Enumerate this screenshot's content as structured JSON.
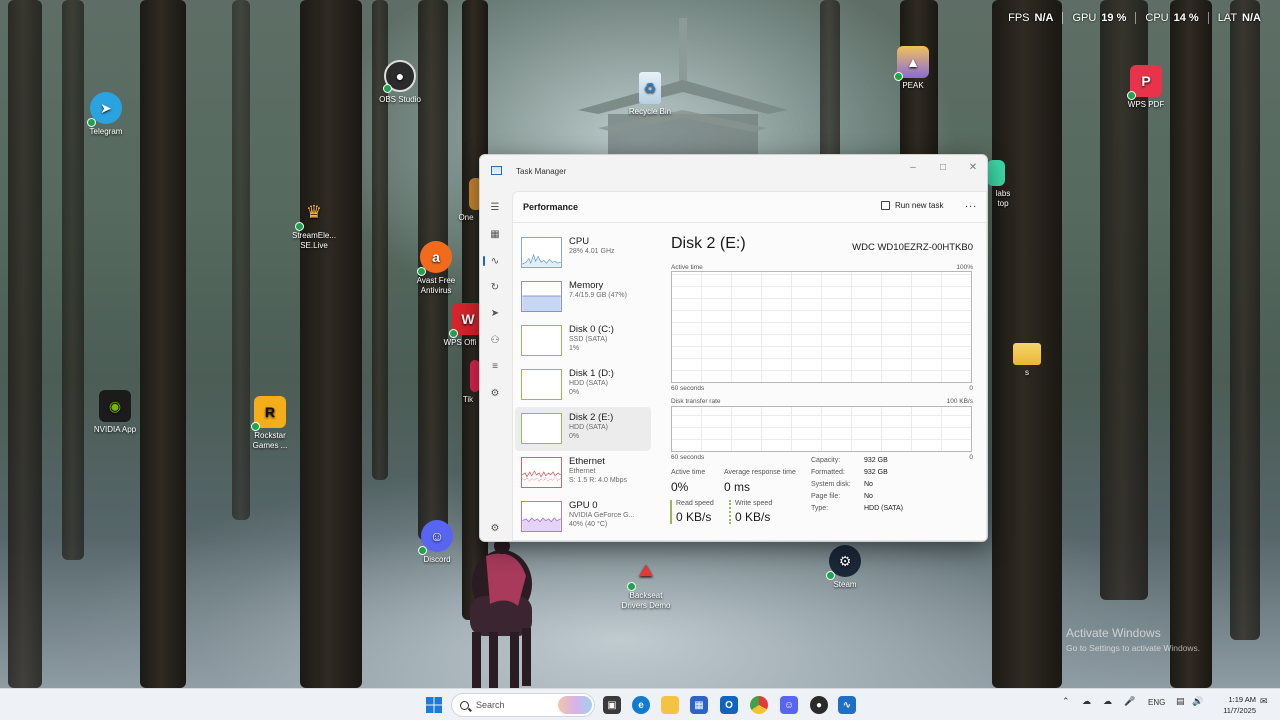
{
  "overlay": [
    {
      "key": "FPS",
      "value": "N/A"
    },
    {
      "key": "GPU",
      "value": "19 %"
    },
    {
      "key": "CPU",
      "value": "14 %"
    },
    {
      "key": "LAT",
      "value": "N/A"
    }
  ],
  "desktop": {
    "telegram": "Telegram",
    "obs": "OBS Studio",
    "recycle": "Recycle Bin",
    "peak": "PEAK",
    "wpspdf": "WPS PDF",
    "streamelements_1": "StreamEle...",
    "streamelements_2": "SE.Live",
    "avast_1": "Avast Free",
    "avast_2": "Antivirus",
    "wpsoffice": "WPS Offi",
    "nvidia": "NVIDIA App",
    "rockstar_1": "Rockstar",
    "rockstar_2": "Games ...",
    "discord": "Discord",
    "backseat_1": "Backseat",
    "backseat_2": "Drivers Demo",
    "steam": "Steam",
    "folder_s": "s",
    "partial_one": "One",
    "partial_tik": "Tik",
    "partial_labs": "labs",
    "partial_top": "top"
  },
  "taskmanager": {
    "title": "Task Manager",
    "page_title": "Performance",
    "run_new_task": "Run new task",
    "more": "...",
    "items": [
      {
        "name": "CPU",
        "sub1": "28%  4.01 GHz",
        "sub2": ""
      },
      {
        "name": "Memory",
        "sub1": "7.4/15.9 GB (47%)",
        "sub2": ""
      },
      {
        "name": "Disk 0 (C:)",
        "sub1": "SSD (SATA)",
        "sub2": "1%"
      },
      {
        "name": "Disk 1 (D:)",
        "sub1": "HDD (SATA)",
        "sub2": "0%"
      },
      {
        "name": "Disk 2 (E:)",
        "sub1": "HDD (SATA)",
        "sub2": "0%"
      },
      {
        "name": "Ethernet",
        "sub1": "Ethernet",
        "sub2": "S: 1.5  R: 4.0 Mbps"
      },
      {
        "name": "GPU 0",
        "sub1": "NVIDIA GeForce G...",
        "sub2": "40% (40 °C)"
      }
    ],
    "selected_index": 4,
    "detail": {
      "title": "Disk 2 (E:)",
      "model": "WDC WD10EZRZ-00HTKB0",
      "active_time_label": "Active time",
      "active_time_max": "100%",
      "sixty_seconds_1": "60 seconds",
      "zero_1": "0",
      "transfer_label": "Disk transfer rate",
      "transfer_max": "100 KB/s",
      "sixty_seconds_2": "60 seconds",
      "zero_2": "0",
      "stat_active_label": "Active time",
      "stat_active_value": "0%",
      "stat_resp_label": "Average response time",
      "stat_resp_value": "0 ms",
      "read_label": "Read speed",
      "read_value": "0 KB/s",
      "write_label": "Write speed",
      "write_value": "0 KB/s",
      "props": [
        {
          "k": "Capacity:",
          "v": "932 GB"
        },
        {
          "k": "Formatted:",
          "v": "932 GB"
        },
        {
          "k": "System disk:",
          "v": "No"
        },
        {
          "k": "Page file:",
          "v": "No"
        },
        {
          "k": "Type:",
          "v": "HDD (SATA)"
        }
      ]
    }
  },
  "activate": {
    "line1": "Activate Windows",
    "line2": "Go to Settings to activate Windows."
  },
  "taskbar": {
    "search_placeholder": "Search",
    "lang": "ENG",
    "time": "1:19 AM",
    "date": "11/7/2025"
  },
  "colors": {
    "accent": "#2363c7",
    "disk_graph_border": "#9ab85a",
    "taskbar_bg": "#eef1f5"
  }
}
